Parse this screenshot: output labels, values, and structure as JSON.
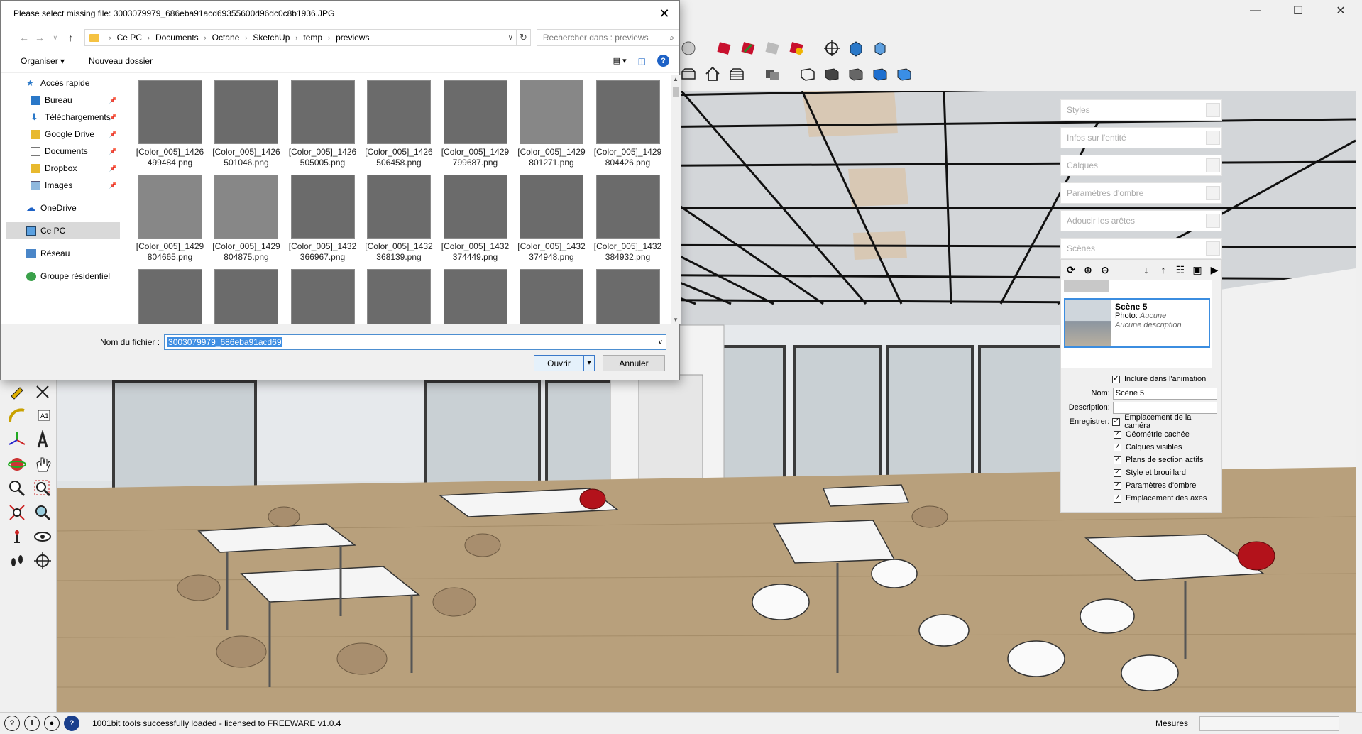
{
  "dialog": {
    "title": "Please select missing file: 3003079979_686eba91acd69355600d96dc0c8b1936.JPG",
    "breadcrumb": [
      "Ce PC",
      "Documents",
      "Octane",
      "SketchUp",
      "temp",
      "previews"
    ],
    "search_placeholder": "Rechercher dans : previews",
    "commands": {
      "organize": "Organiser ▾",
      "new_folder": "Nouveau dossier"
    },
    "nav": {
      "quick_access": "Accès rapide",
      "items": [
        "Bureau",
        "Téléchargements",
        "Google Drive",
        "Documents",
        "Dropbox",
        "Images"
      ],
      "onedrive": "OneDrive",
      "this_pc": "Ce PC",
      "network": "Réseau",
      "homegroup": "Groupe résidentiel"
    },
    "files": [
      {
        "l1": "[Color_005]_1426",
        "l2": "499484.png"
      },
      {
        "l1": "[Color_005]_1426",
        "l2": "501046.png"
      },
      {
        "l1": "[Color_005]_1426",
        "l2": "505005.png"
      },
      {
        "l1": "[Color_005]_1426",
        "l2": "506458.png"
      },
      {
        "l1": "[Color_005]_1429",
        "l2": "799687.png"
      },
      {
        "l1": "[Color_005]_1429",
        "l2": "801271.png"
      },
      {
        "l1": "[Color_005]_1429",
        "l2": "804426.png"
      },
      {
        "l1": "[Color_005]_1429",
        "l2": "804665.png"
      },
      {
        "l1": "[Color_005]_1429",
        "l2": "804875.png"
      },
      {
        "l1": "[Color_005]_1432",
        "l2": "366967.png"
      },
      {
        "l1": "[Color_005]_1432",
        "l2": "368139.png"
      },
      {
        "l1": "[Color_005]_1432",
        "l2": "374449.png"
      },
      {
        "l1": "[Color_005]_1432",
        "l2": "374948.png"
      },
      {
        "l1": "[Color_005]_1432",
        "l2": "384932.png"
      }
    ],
    "filename_label": "Nom du fichier :",
    "filename_value": "3003079979_686eba91acd69",
    "open_label": "Ouvrir",
    "cancel_label": "Annuler"
  },
  "tray": {
    "panels": [
      "Styles",
      "Infos sur l'entité",
      "Calques",
      "Paramètres d'ombre",
      "Adoucir les arêtes",
      "Scènes"
    ],
    "scene": {
      "name": "Scène 5",
      "photo_label": "Photo:",
      "photo_value": "Aucune",
      "description": "Aucune description"
    },
    "include_animation": "Inclure dans l'animation",
    "name_label": "Nom:",
    "name_value": "Scène 5",
    "description_label": "Description:",
    "save_label": "Enregistrer:",
    "save_options": [
      "Emplacement de la caméra",
      "Géométrie cachée",
      "Calques visibles",
      "Plans de section actifs",
      "Style et brouillard",
      "Paramètres d'ombre",
      "Emplacement des axes"
    ]
  },
  "status": {
    "message": "1001bit tools successfully loaded - licensed to FREEWARE v1.0.4",
    "measures_label": "Mesures"
  },
  "colors": {
    "accent": "#3b8de0",
    "floor": "#b8a07c",
    "ceiling_tile": "#d8c8b4"
  }
}
